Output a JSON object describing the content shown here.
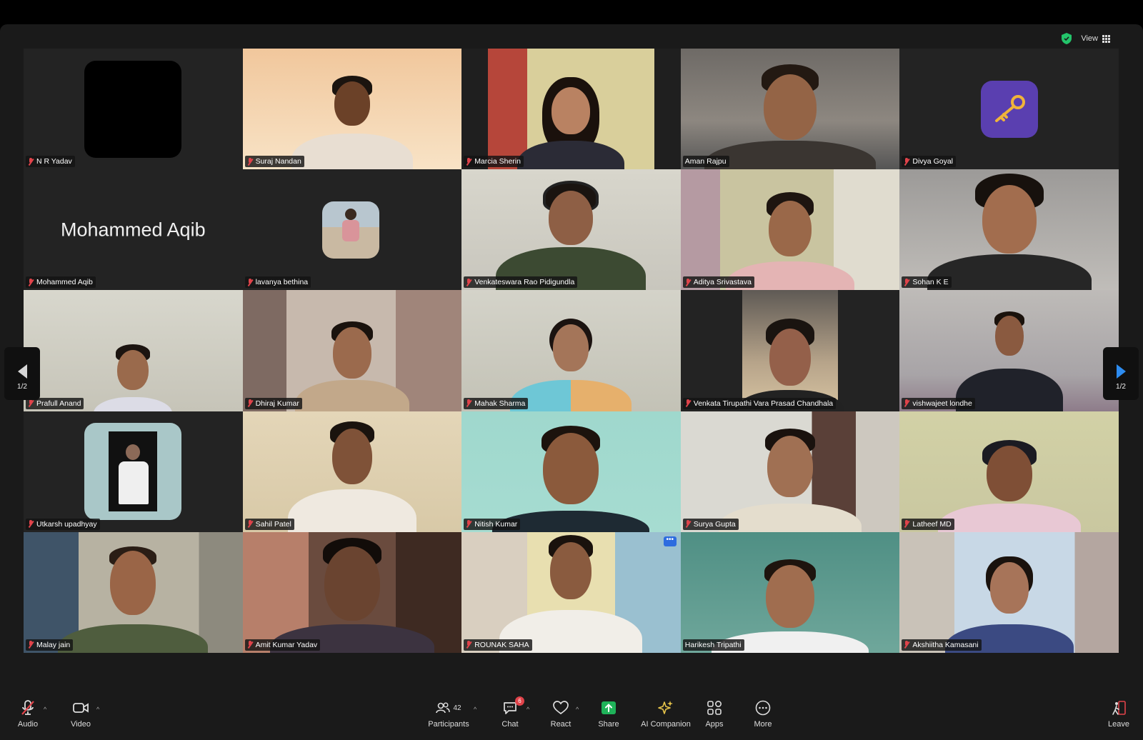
{
  "window": {
    "view_label": "View"
  },
  "pager": {
    "left_label": "1/2",
    "right_label": "1/2"
  },
  "featured": {
    "display_name": "Mohammed Aqib"
  },
  "participants": [
    "N R Yadav",
    "Suraj Nandan",
    "Marcia Sherin",
    "Aman Rajpu",
    "Divya Goyal",
    "Mohammed Aqib",
    "lavanya bethina",
    "Venkateswara Rao Pidigundla",
    "Aditya Srivastava",
    "Sohan K E",
    "Prafull Anand",
    "Dhiraj Kumar",
    "Mahak Sharma",
    "Venkata Tirupathi Vara Prasad Chandhala",
    "vishwajeet londhe",
    "Utkarsh upadhyay",
    "Sahil Patel",
    "Nitish Kumar",
    "Surya Gupta",
    "Latheef MD",
    "Malay jain",
    "Amit Kumar Yadav",
    "ROUNAK SAHA",
    "Harikesh Tripathi",
    "Akshiitha Kamasani"
  ],
  "toolbar": {
    "audio": "Audio",
    "video": "Video",
    "participants": "Participants",
    "participants_count": "42",
    "chat": "Chat",
    "chat_badge": "6",
    "react": "React",
    "share": "Share",
    "ai_companion": "AI Companion",
    "apps": "Apps",
    "more": "More",
    "leave": "Leave"
  },
  "colors": {
    "active_speaker": "#3cc36a",
    "muted_mic": "#e0434a",
    "share_green": "#1fb259",
    "pager_arrow": "#2d8cf0"
  },
  "icons": [
    "shield-icon",
    "grid-view-icon",
    "mic-off-icon",
    "camera-icon",
    "participants-icon",
    "chat-icon",
    "heart-icon",
    "share-screen-icon",
    "sparkle-icon",
    "apps-icon",
    "more-icon",
    "leave-icon"
  ]
}
